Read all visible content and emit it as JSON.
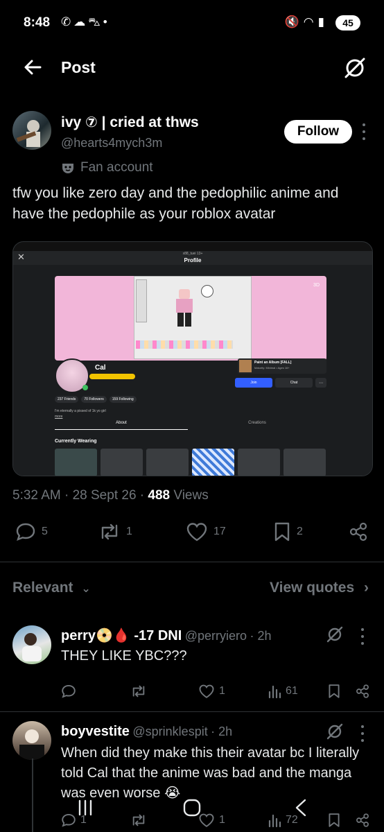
{
  "status_bar": {
    "time": "8:48",
    "battery": "45",
    "left_icons": [
      "whatsapp-icon",
      "cloud-icon",
      "car-icon",
      "dot-icon"
    ],
    "right_icons": [
      "mute-icon",
      "wifi-icon",
      "signal-icon"
    ]
  },
  "header": {
    "title": "Post"
  },
  "post": {
    "author_name": "ivy ⑦ | cried at thws",
    "author_handle": "@hearts4mych3m",
    "follow_label": "Follow",
    "badge": "Fan account",
    "text": "tfw you like zero day and the pedophilic anime and have the pedophile as your roblox avatar",
    "timestamp": "5:32 AM · 28 Sept 26 · ",
    "views_count": "488",
    "views_label": " Views",
    "replies": "5",
    "reposts": "1",
    "likes": "17",
    "bookmarks": "2"
  },
  "embedded_screenshot": {
    "window_subtitle": "x88_tuei 13+",
    "window_title": "Profile",
    "badge_3d": "3D",
    "profile_name": "Cal",
    "friends": "237 Friends",
    "followers": "70 Followers",
    "following": "159 Following",
    "bio": "I'm eternally a pissed of 1k yo girl",
    "more": "more",
    "tab_about": "About",
    "tab_creations": "Creations",
    "experience_title": "Paint an Album [FALL]",
    "experience_sub": "Maturity: Minimal • Ages 16+",
    "join_label": "Join",
    "chat_label": "Chat",
    "wearing_title": "Currently Wearing"
  },
  "filters": {
    "relevant": "Relevant",
    "view_quotes": "View quotes"
  },
  "replies": [
    {
      "name": "perry📀🩸 -17 DNI",
      "handle": "@perryiero",
      "time": "· 2h",
      "text": "THEY LIKE YBC???",
      "likes": "1",
      "views": "61"
    },
    {
      "name": "boyvestite",
      "handle": "@sprinklespit",
      "time": "· 2h",
      "text": "When did they make this their avatar bc I literally told Cal that the anime was bad and the manga was even worse 😭",
      "replies": "1",
      "likes": "1",
      "views": "72"
    }
  ],
  "colors": {
    "background": "#000000",
    "text": "#e7e9ea",
    "muted": "#71767b",
    "divider": "#2f3336",
    "roblox_blue": "#335fff",
    "profile_pink": "#f2b6d9"
  }
}
